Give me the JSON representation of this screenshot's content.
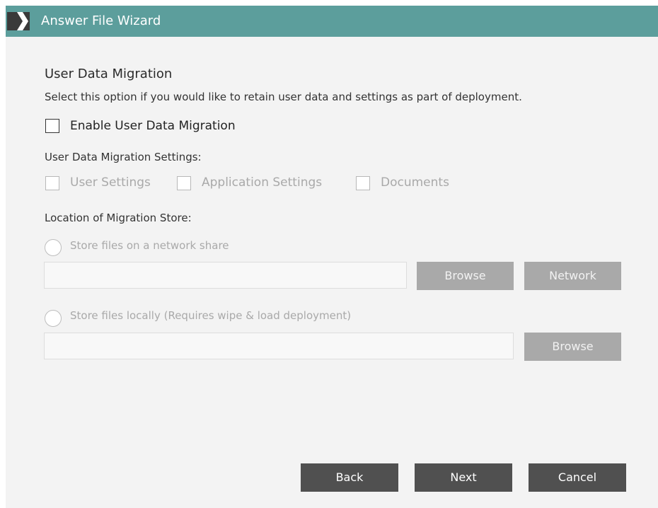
{
  "window": {
    "title": "Answer File Wizard",
    "logo_icon": "chevron-logo-icon",
    "titlebar_color": "#5c9e9c"
  },
  "section": {
    "heading": "User Data Migration",
    "description": "Select this option if you would like to retain user data and settings as part of deployment."
  },
  "enable": {
    "label": "Enable User Data Migration",
    "checked": false
  },
  "settings": {
    "label": "User Data Migration Settings:",
    "options": [
      {
        "label": "User Settings",
        "checked": false,
        "enabled": false
      },
      {
        "label": "Application Settings",
        "checked": false,
        "enabled": false
      },
      {
        "label": "Documents",
        "checked": false,
        "enabled": false
      }
    ]
  },
  "location": {
    "label": "Location of Migration Store:",
    "network": {
      "label": "Store files on a network share",
      "path_value": "",
      "browse_label": "Browse",
      "network_label": "Network"
    },
    "local": {
      "label": "Store files locally (Requires wipe & load deployment)",
      "path_value": "",
      "browse_label": "Browse"
    }
  },
  "footer": {
    "back_label": "Back",
    "next_label": "Next",
    "cancel_label": "Cancel"
  }
}
